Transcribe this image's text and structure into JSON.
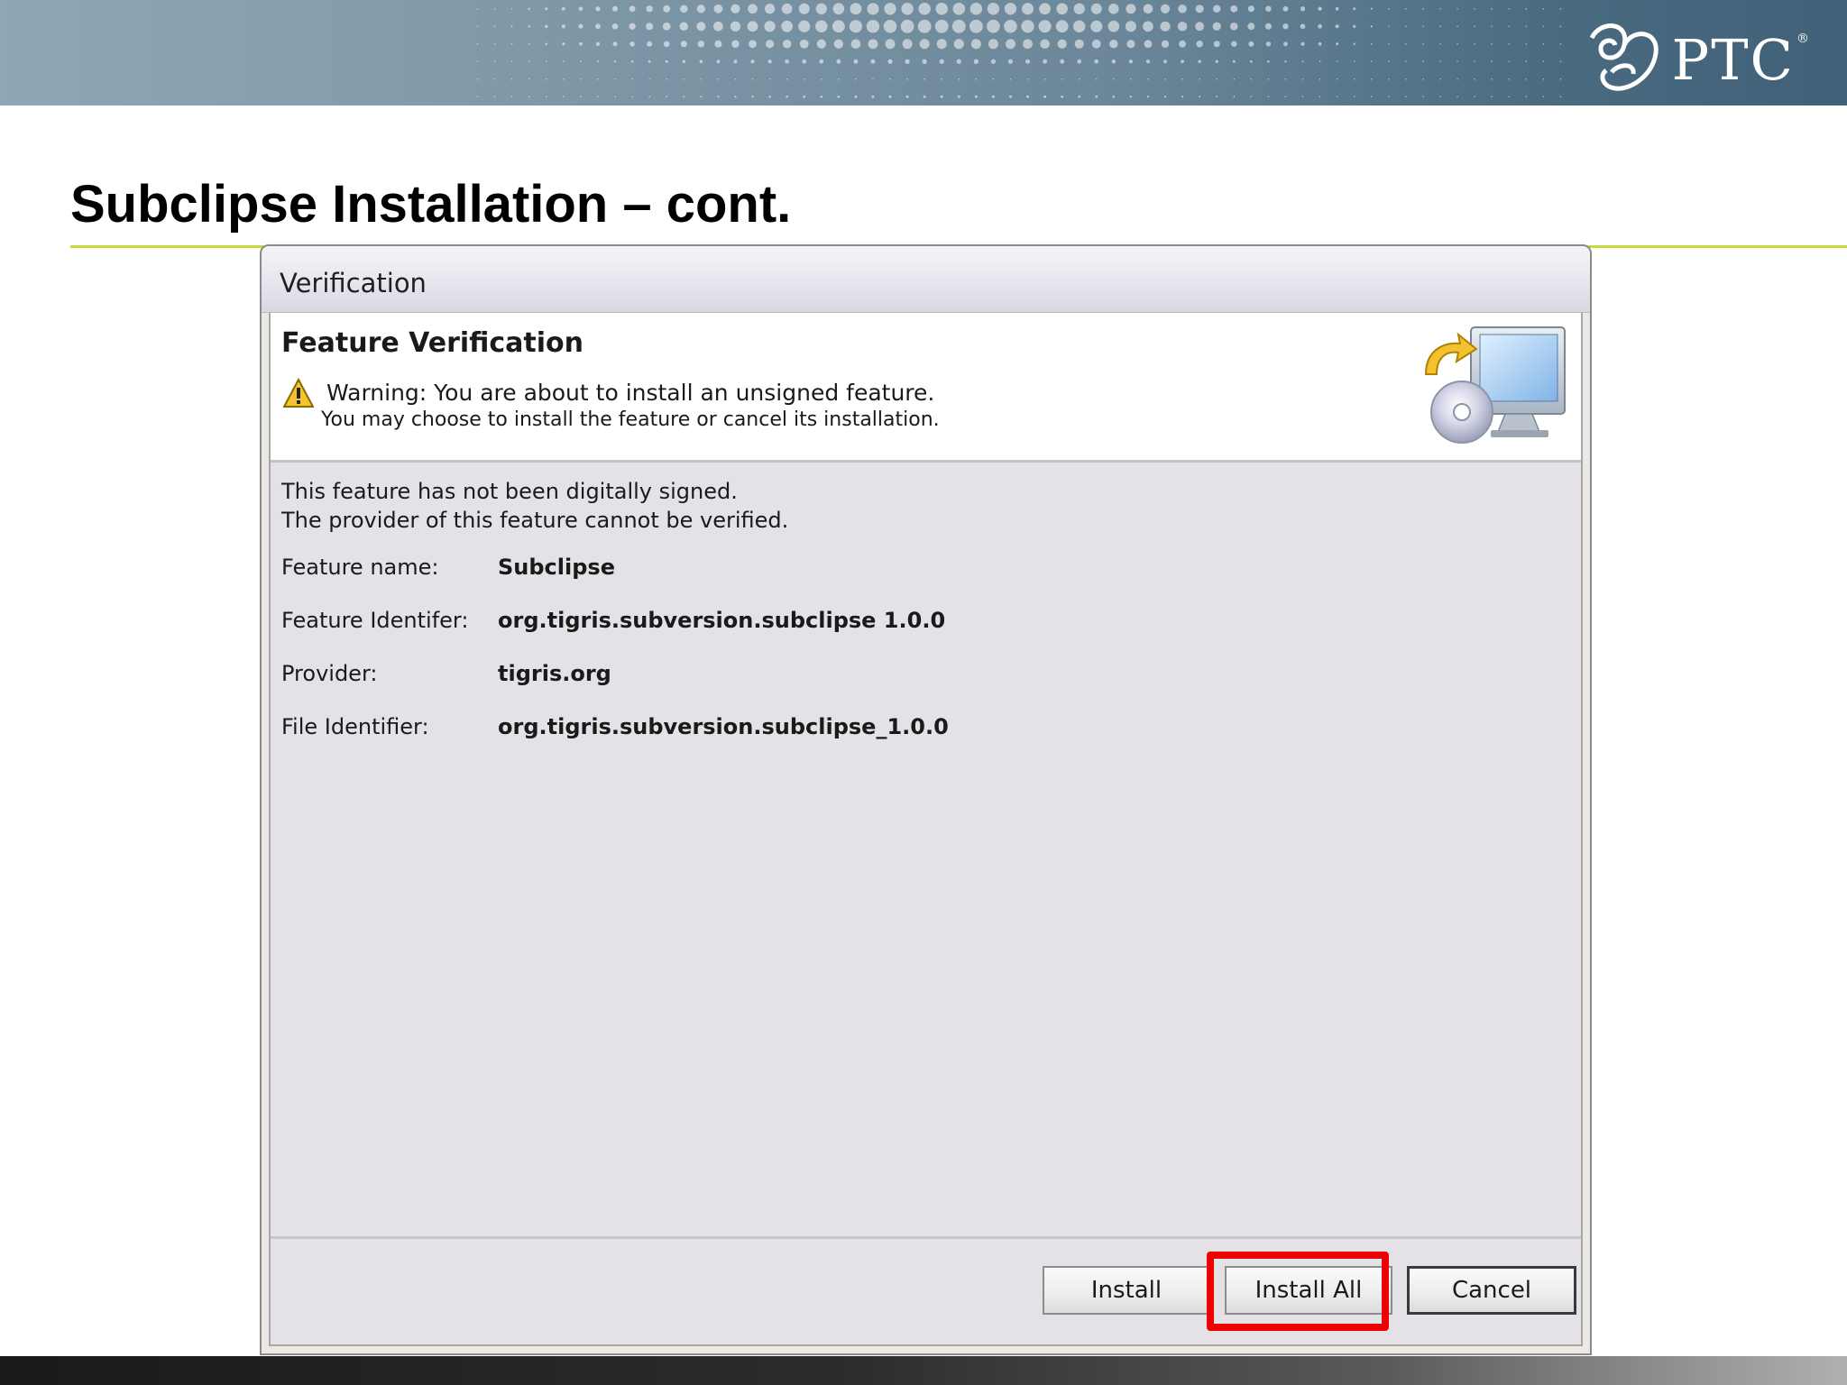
{
  "banner": {
    "logo_text": "PTC",
    "logo_reg": "®"
  },
  "slide": {
    "title": "Subclipse Installation – cont."
  },
  "dialog": {
    "window_title": "Verification",
    "header": {
      "title": "Feature Verification",
      "warning_line1": "Warning: You are about to install an unsigned feature.",
      "warning_line2": "You may choose to install the feature or cancel its installation."
    },
    "notes": {
      "line1": "This feature has not been digitally signed.",
      "line2": "The provider of this feature cannot be verified."
    },
    "details": [
      {
        "label": "Feature name:",
        "value": "Subclipse"
      },
      {
        "label": "Feature Identifer:",
        "value": "org.tigris.subversion.subclipse  1.0.0"
      },
      {
        "label": "Provider:",
        "value": "tigris.org"
      },
      {
        "label": "File Identifier:",
        "value": "org.tigris.subversion.subclipse_1.0.0"
      }
    ],
    "buttons": {
      "install": "Install",
      "install_all": "Install All",
      "cancel": "Cancel"
    }
  },
  "colors": {
    "accent_rule": "#c8d83a",
    "highlight": "#ee0000",
    "banner": "#6b8799"
  },
  "icons": {
    "warning": "warning-triangle-icon",
    "install": "install-computer-cd-icon",
    "logo": "ptc-logo-icon"
  }
}
